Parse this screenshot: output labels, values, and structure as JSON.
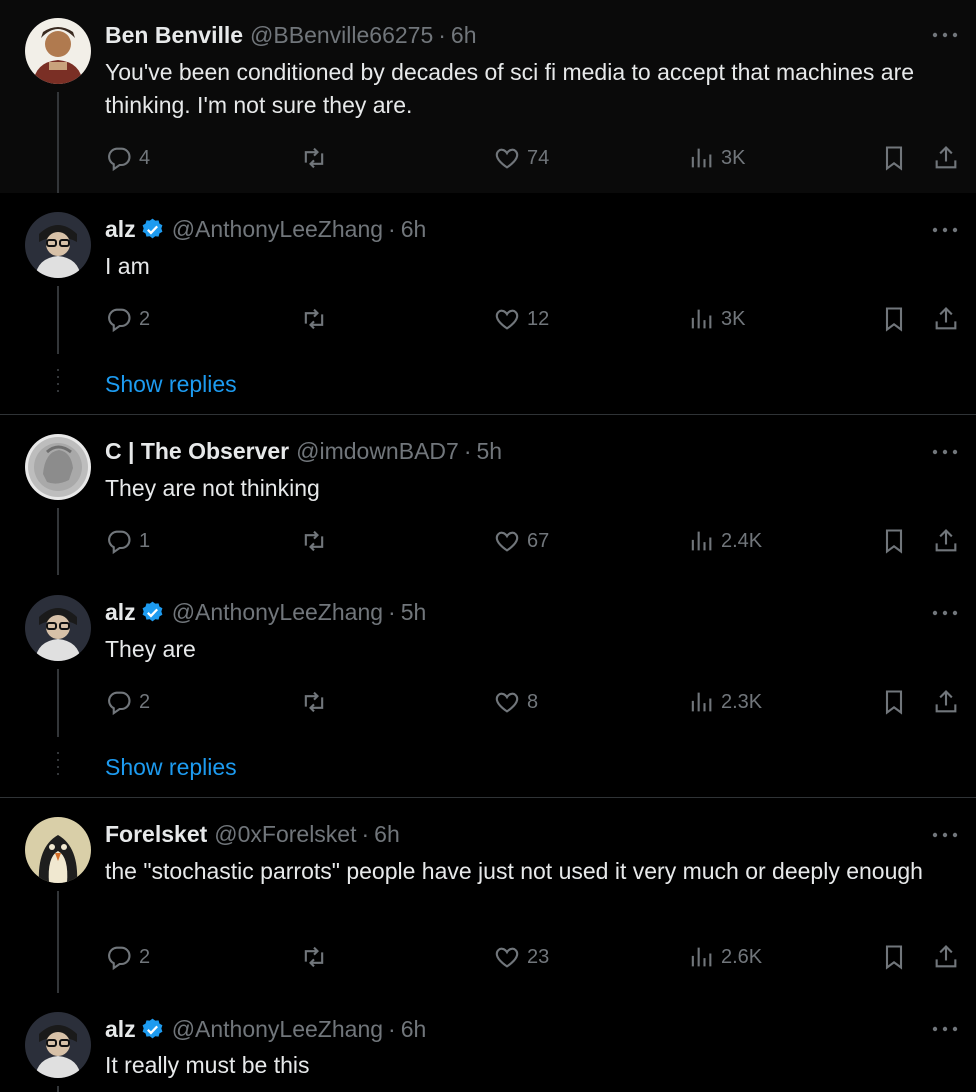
{
  "tweets": [
    {
      "name": "Ben Benville",
      "handle": "@BBenville66275",
      "time": "6h",
      "verified": false,
      "text": "You've been conditioned by decades of sci fi media to accept that machines are thinking.  I'm not sure they are.",
      "replies": "4",
      "retweets": "",
      "likes": "74",
      "views": "3K",
      "avatar_colors": [
        "#8a6a4a",
        "#c9a27c",
        "#3a2a20"
      ]
    },
    {
      "name": "alz",
      "handle": "@AnthonyLeeZhang",
      "time": "6h",
      "verified": true,
      "text": "I am",
      "replies": "2",
      "retweets": "",
      "likes": "12",
      "views": "3K",
      "avatar_colors": [
        "#2b2f3a",
        "#d7d7d7",
        "#1a1a1a"
      ]
    },
    {
      "name": "C | The Observer",
      "handle": "@imdownBAD7",
      "time": "5h",
      "verified": false,
      "text": "They are not thinking",
      "replies": "1",
      "retweets": "",
      "likes": "67",
      "views": "2.4K",
      "avatar_colors": [
        "#b8b8b8",
        "#e4e4e4",
        "#6f6f6f"
      ]
    },
    {
      "name": "alz",
      "handle": "@AnthonyLeeZhang",
      "time": "5h",
      "verified": true,
      "text": "They are",
      "replies": "2",
      "retweets": "",
      "likes": "8",
      "views": "2.3K",
      "avatar_colors": [
        "#2b2f3a",
        "#d7d7d7",
        "#1a1a1a"
      ]
    },
    {
      "name": "Forelsket",
      "handle": "@0xForelsket",
      "time": "6h",
      "verified": false,
      "text": "the \"stochastic parrots\" people have just not used it very much or deeply enough",
      "replies": "2",
      "retweets": "",
      "likes": "23",
      "views": "2.6K",
      "avatar_colors": [
        "#d9cfa8",
        "#1e1e1e",
        "#f0e8d0"
      ]
    },
    {
      "name": "alz",
      "handle": "@AnthonyLeeZhang",
      "time": "6h",
      "verified": true,
      "text": "It really must be this",
      "avatar_colors": [
        "#2b2f3a",
        "#d7d7d7",
        "#1a1a1a"
      ]
    }
  ],
  "show_replies_label": "Show replies",
  "separator": "·",
  "colors": {
    "accent": "#1d9bf0",
    "muted": "#71767b",
    "text": "#e7e9ea",
    "background": "#000000"
  }
}
